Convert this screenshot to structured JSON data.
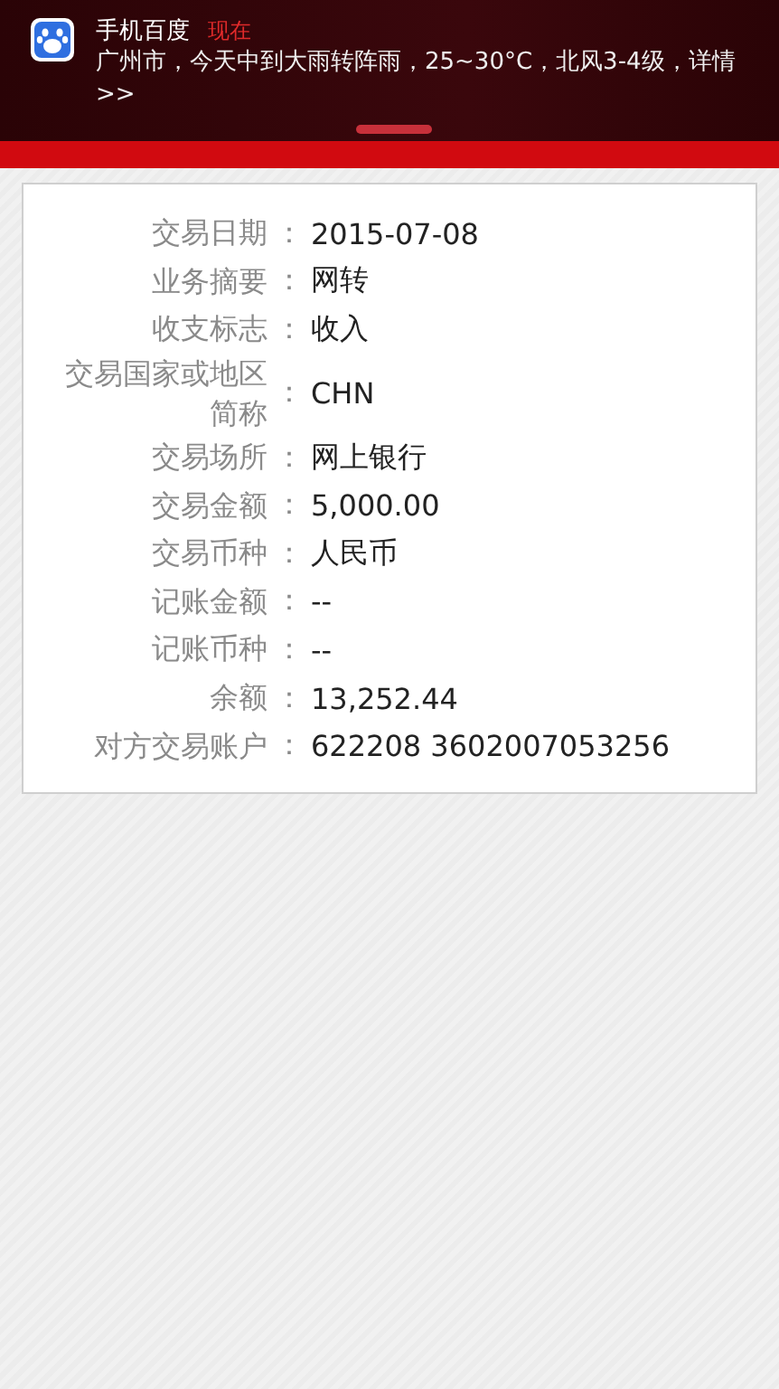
{
  "notification": {
    "app": "手机百度",
    "time": "现在",
    "message": "广州市，今天中到大雨转阵雨，25~30°C，北风3-4级，详情>>"
  },
  "details": [
    {
      "label": "交易日期",
      "separator": "：",
      "value": "2015-07-08"
    },
    {
      "label": "业务摘要",
      "separator": "：",
      "value": "网转"
    },
    {
      "label": "收支标志",
      "separator": "：",
      "value": "收入"
    },
    {
      "label": "交易国家或地区简称",
      "separator": "：",
      "value": "CHN"
    },
    {
      "label": "交易场所",
      "separator": "：",
      "value": "网上银行"
    },
    {
      "label": "交易金额",
      "separator": "：",
      "value": "5,000.00"
    },
    {
      "label": "交易币种",
      "separator": "：",
      "value": "人民币"
    },
    {
      "label": "记账金额",
      "separator": "：",
      "value": "--"
    },
    {
      "label": "记账币种",
      "separator": "：",
      "value": "--"
    },
    {
      "label": "余额",
      "separator": "：",
      "value": "13,252.44"
    },
    {
      "label": "对方交易账户",
      "separator": "：",
      "value": "622208 3602007053256"
    }
  ]
}
